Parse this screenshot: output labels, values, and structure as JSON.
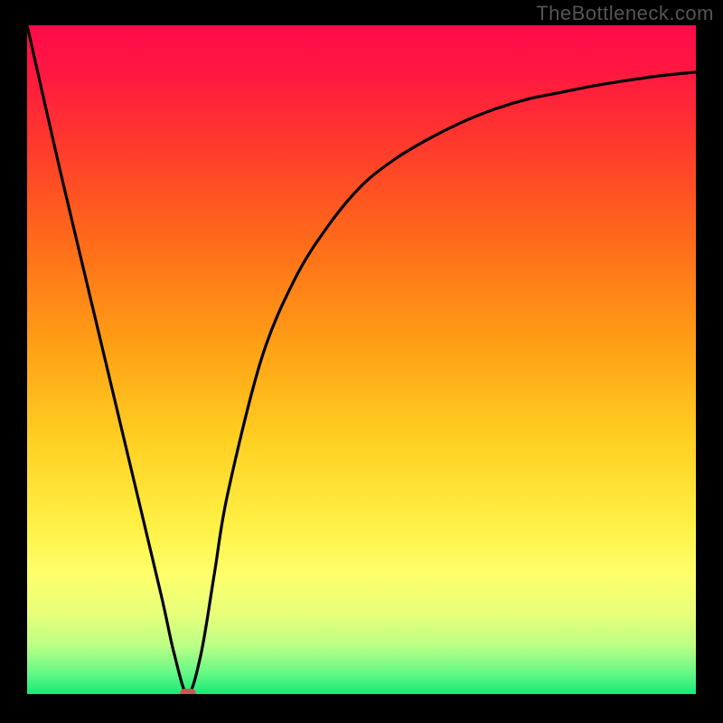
{
  "watermark": "TheBottleneck.com",
  "chart_data": {
    "type": "line",
    "title": "",
    "xlabel": "",
    "ylabel": "",
    "xlim": [
      0,
      100
    ],
    "ylim": [
      0,
      100
    ],
    "grid": false,
    "legend": false,
    "series": [
      {
        "name": "curve",
        "x": [
          0,
          5,
          10,
          15,
          20,
          22,
          24,
          26,
          28,
          30,
          35,
          40,
          45,
          50,
          55,
          60,
          65,
          70,
          75,
          80,
          85,
          90,
          95,
          100
        ],
        "values": [
          100,
          78,
          57,
          36,
          15,
          6,
          0,
          6,
          18,
          30,
          50,
          62,
          70,
          76,
          80,
          83,
          85.5,
          87.5,
          89,
          90,
          91,
          91.8,
          92.5,
          93
        ]
      }
    ],
    "marker": {
      "x": 24,
      "y": 0,
      "color": "#c35a54"
    },
    "gradient_stops": [
      {
        "offset": 0.0,
        "color": "#ff0a4a"
      },
      {
        "offset": 0.07,
        "color": "#ff1840"
      },
      {
        "offset": 0.18,
        "color": "#ff3a2c"
      },
      {
        "offset": 0.32,
        "color": "#ff6a1a"
      },
      {
        "offset": 0.48,
        "color": "#ffa015"
      },
      {
        "offset": 0.62,
        "color": "#ffd022"
      },
      {
        "offset": 0.75,
        "color": "#fff146"
      },
      {
        "offset": 0.82,
        "color": "#feff6a"
      },
      {
        "offset": 0.88,
        "color": "#e8ff7a"
      },
      {
        "offset": 0.93,
        "color": "#b8ff86"
      },
      {
        "offset": 0.97,
        "color": "#61f885"
      },
      {
        "offset": 1.0,
        "color": "#18e878"
      }
    ]
  }
}
